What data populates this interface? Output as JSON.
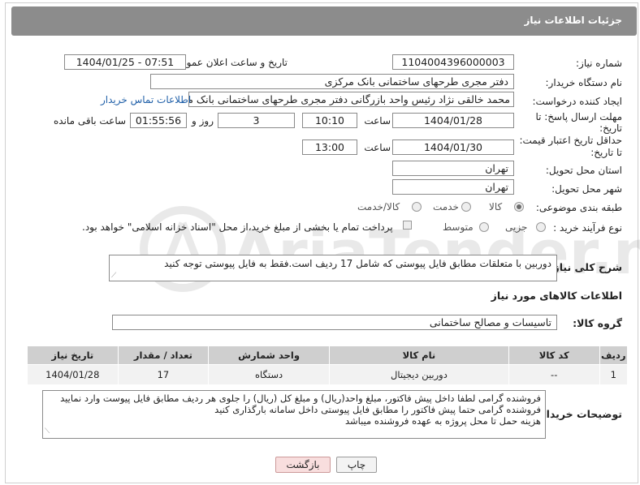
{
  "header": {
    "title": "جزئیات اطلاعات نیاز"
  },
  "fields": {
    "need_number_label": "شماره نیاز:",
    "need_number": "1104004396000003",
    "announce_label": "تاریخ و ساعت اعلان عمومی:",
    "announce_value": "1404/01/25 - 07:51",
    "buyer_org_label": "نام دستگاه خریدار:",
    "buyer_org": "دفتر مجری طرحهای ساختمانی بانک مرکزی",
    "creator_label": "ایجاد کننده درخواست:",
    "creator": "محمد خالقی نژاد رئیس واحد بازرگانی دفتر مجری طرحهای ساختمانی بانک مرکز",
    "contact_link": "اطلاعات تماس خریدار",
    "deadline_label_1": "مهلت ارسال پاسخ: تا",
    "deadline_label_2": "تاریخ:",
    "deadline_date": "1404/01/28",
    "time_label": "ساعت",
    "deadline_time": "10:10",
    "days_value": "3",
    "days_label": "روز و",
    "remaining_value": "01:55:56",
    "remaining_label": "ساعت باقی مانده",
    "validity_label_1": "حداقل تاریخ اعتبار قیمت:",
    "validity_label_2": "تا تاریخ:",
    "validity_date": "1404/01/30",
    "validity_time": "13:00",
    "province_label": "استان محل تحویل:",
    "province": "تهران",
    "city_label": "شهر محل تحویل:",
    "city": "تهران",
    "category_label": "طبقه بندی موضوعی:",
    "category_options": [
      "کالا",
      "خدمت",
      "کالا/خدمت"
    ],
    "process_label": "نوع فرآیند خرید :",
    "process_options": [
      "جزیی",
      "متوسط"
    ],
    "payment_note": "پرداخت تمام یا بخشی از مبلغ خرید،از محل \"اسناد خزانه اسلامی\" خواهد بود."
  },
  "description": {
    "label": "شرح کلی نیاز:",
    "text": "دوربین با متعلقات مطابق فایل پیوستی که شامل 17 ردیف است.فقط به فایل پیوستی توجه کنید"
  },
  "goods": {
    "section_title": "اطلاعات کالاهای مورد نیاز",
    "group_label": "گروه کالا:",
    "group_value": "تاسیسات و مصالح ساختمانی",
    "columns": [
      "ردیف",
      "کد کالا",
      "نام کالا",
      "واحد شمارش",
      "تعداد / مقدار",
      "تاریخ نیاز"
    ],
    "rows": [
      [
        "1",
        "--",
        "دوربین دیجیتال",
        "دستگاه",
        "17",
        "1404/01/28"
      ]
    ]
  },
  "buyer_notes": {
    "label": "توضیحات خریدار:",
    "line1": "فروشنده گرامی لطفا داخل پیش فاکتور، مبلغ واحد(ریال) و مبلغ کل (ریال) را جلوی هر ردیف  مطابق فایل پیوست وارد نمایید",
    "line2": "فروشنده گرامی حتما پیش فاکتور را مطابق فایل پیوستی داخل سامانه بارگذاری کنید",
    "line3": "هزینه حمل تا محل پروژه  به عهده فروشنده میباشد"
  },
  "buttons": {
    "print": "چاپ",
    "back": "بازگشت"
  },
  "watermark": "AriaTender.net"
}
